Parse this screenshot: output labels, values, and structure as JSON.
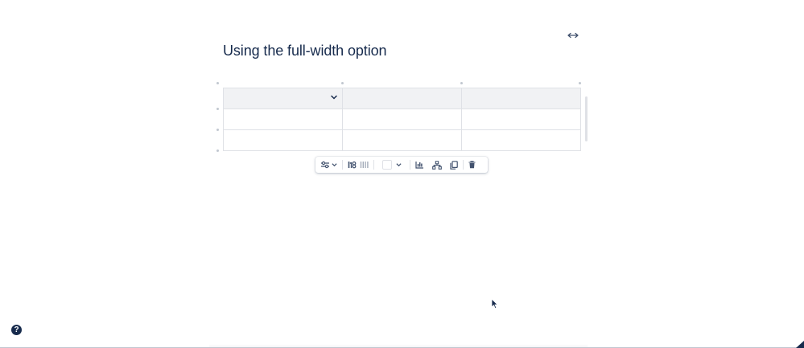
{
  "page": {
    "title": "Using the full-width option"
  },
  "table": {
    "columns": 3,
    "header": [
      "",
      "",
      ""
    ],
    "rows": [
      [
        "",
        "",
        ""
      ],
      [
        "",
        "",
        ""
      ]
    ]
  },
  "toolbar": {
    "items": [
      {
        "name": "table-options",
        "icon": "sliders-icon",
        "has_dropdown": true
      },
      {
        "name": "sort",
        "icon": "sort-icon"
      },
      {
        "name": "distribute-columns",
        "icon": "columns-icon"
      },
      {
        "name": "cell-background",
        "icon": "color-swatch",
        "has_dropdown": true
      },
      {
        "name": "insert-chart",
        "icon": "chart-icon"
      },
      {
        "name": "table-hierarchy",
        "icon": "hierarchy-icon"
      },
      {
        "name": "copy",
        "icon": "copy-icon"
      },
      {
        "name": "delete",
        "icon": "trash-icon"
      }
    ]
  },
  "help": {
    "label": "?"
  },
  "colors": {
    "text": "#172b4d",
    "header_bg": "#f1f2f4",
    "border": "#dfe1e6",
    "icon": "#42526e"
  }
}
